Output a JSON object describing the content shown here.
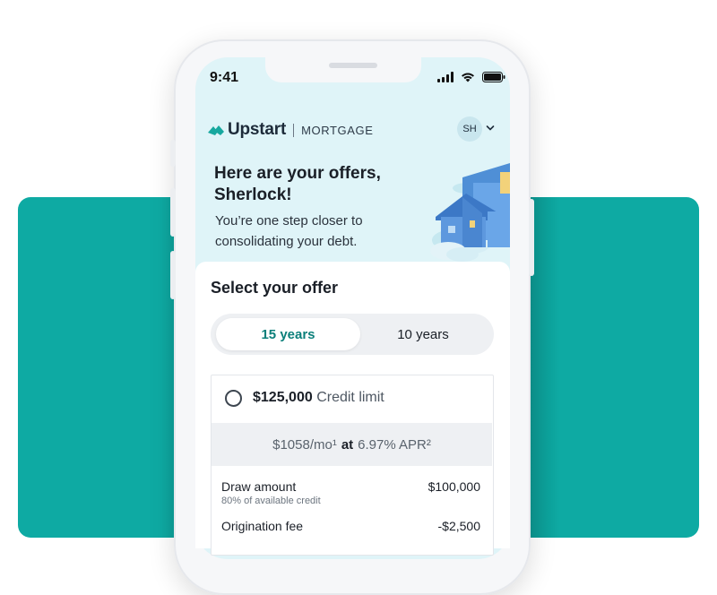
{
  "status_bar": {
    "time": "9:41",
    "icons": [
      "cellular-signal-icon",
      "wifi-icon",
      "battery-icon"
    ]
  },
  "header": {
    "brand": "Upstart",
    "product": "MORTGAGE",
    "user_initials": "SH"
  },
  "hero": {
    "title_line1": "Here are your offers,",
    "title_line2": "Sherlock!",
    "subtitle_line1": "You’re one step closer to",
    "subtitle_line2": "consolidating your debt."
  },
  "offer_section": {
    "title": "Select your offer",
    "tabs": [
      {
        "label": "15 years",
        "selected": true
      },
      {
        "label": "10 years",
        "selected": false
      }
    ],
    "offer": {
      "amount": "$125,000",
      "amount_label": "Credit limit",
      "payment": "$1058/mo¹",
      "at": "at",
      "apr": "6.97% APR²",
      "rows": [
        {
          "label": "Draw amount",
          "sublabel": "80% of available credit",
          "value": "$100,000"
        },
        {
          "label": "Origination fee",
          "value": "-$2,500"
        }
      ]
    }
  },
  "colors": {
    "teal": "#0eaaa3",
    "screen_bg": "#dff4f8",
    "accent_text": "#0b7f7a",
    "logo": "#17a89f"
  }
}
